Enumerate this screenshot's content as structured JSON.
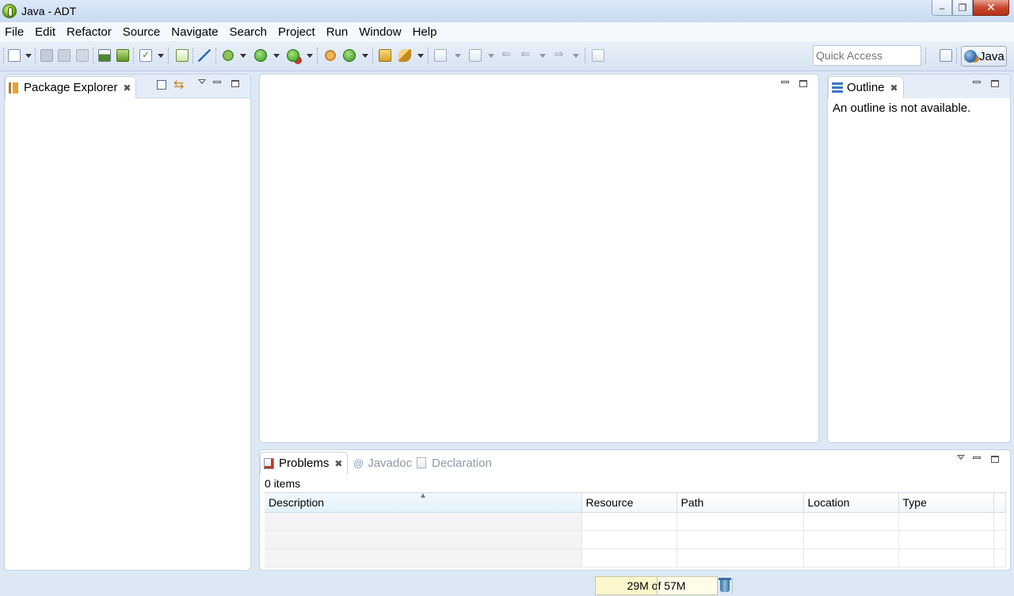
{
  "window": {
    "title": "Java - ADT"
  },
  "menu": [
    "File",
    "Edit",
    "Refactor",
    "Source",
    "Navigate",
    "Search",
    "Project",
    "Run",
    "Window",
    "Help"
  ],
  "toolbar": {
    "quick_access_placeholder": "Quick Access",
    "perspective_label": "Java"
  },
  "package_explorer": {
    "tab_label": "Package Explorer"
  },
  "outline": {
    "tab_label": "Outline",
    "message": "An outline is not available."
  },
  "bottom_panel": {
    "tabs": [
      {
        "label": "Problems",
        "active": true
      },
      {
        "label": "Javadoc",
        "active": false
      },
      {
        "label": "Declaration",
        "active": false
      }
    ],
    "items_count": "0 items",
    "columns": [
      "Description",
      "Resource",
      "Path",
      "Location",
      "Type"
    ]
  },
  "status": {
    "heap": "29M of 57M"
  },
  "icons": {
    "app": "eclipse-adt-icon",
    "toolbar": [
      "new-icon",
      "save-icon",
      "save-all-icon",
      "print-icon",
      "import-icon",
      "sdk-manager-icon",
      "task-icon",
      "lint-icon",
      "skip-breakpoints-icon",
      "debug-icon",
      "run-icon",
      "external-tools-icon",
      "new-package-icon",
      "new-class-icon",
      "open-type-icon",
      "search-icon",
      "next-annotation-icon",
      "prev-annotation-icon",
      "last-edit-icon",
      "back-icon",
      "forward-icon",
      "pin-editor-icon"
    ]
  }
}
